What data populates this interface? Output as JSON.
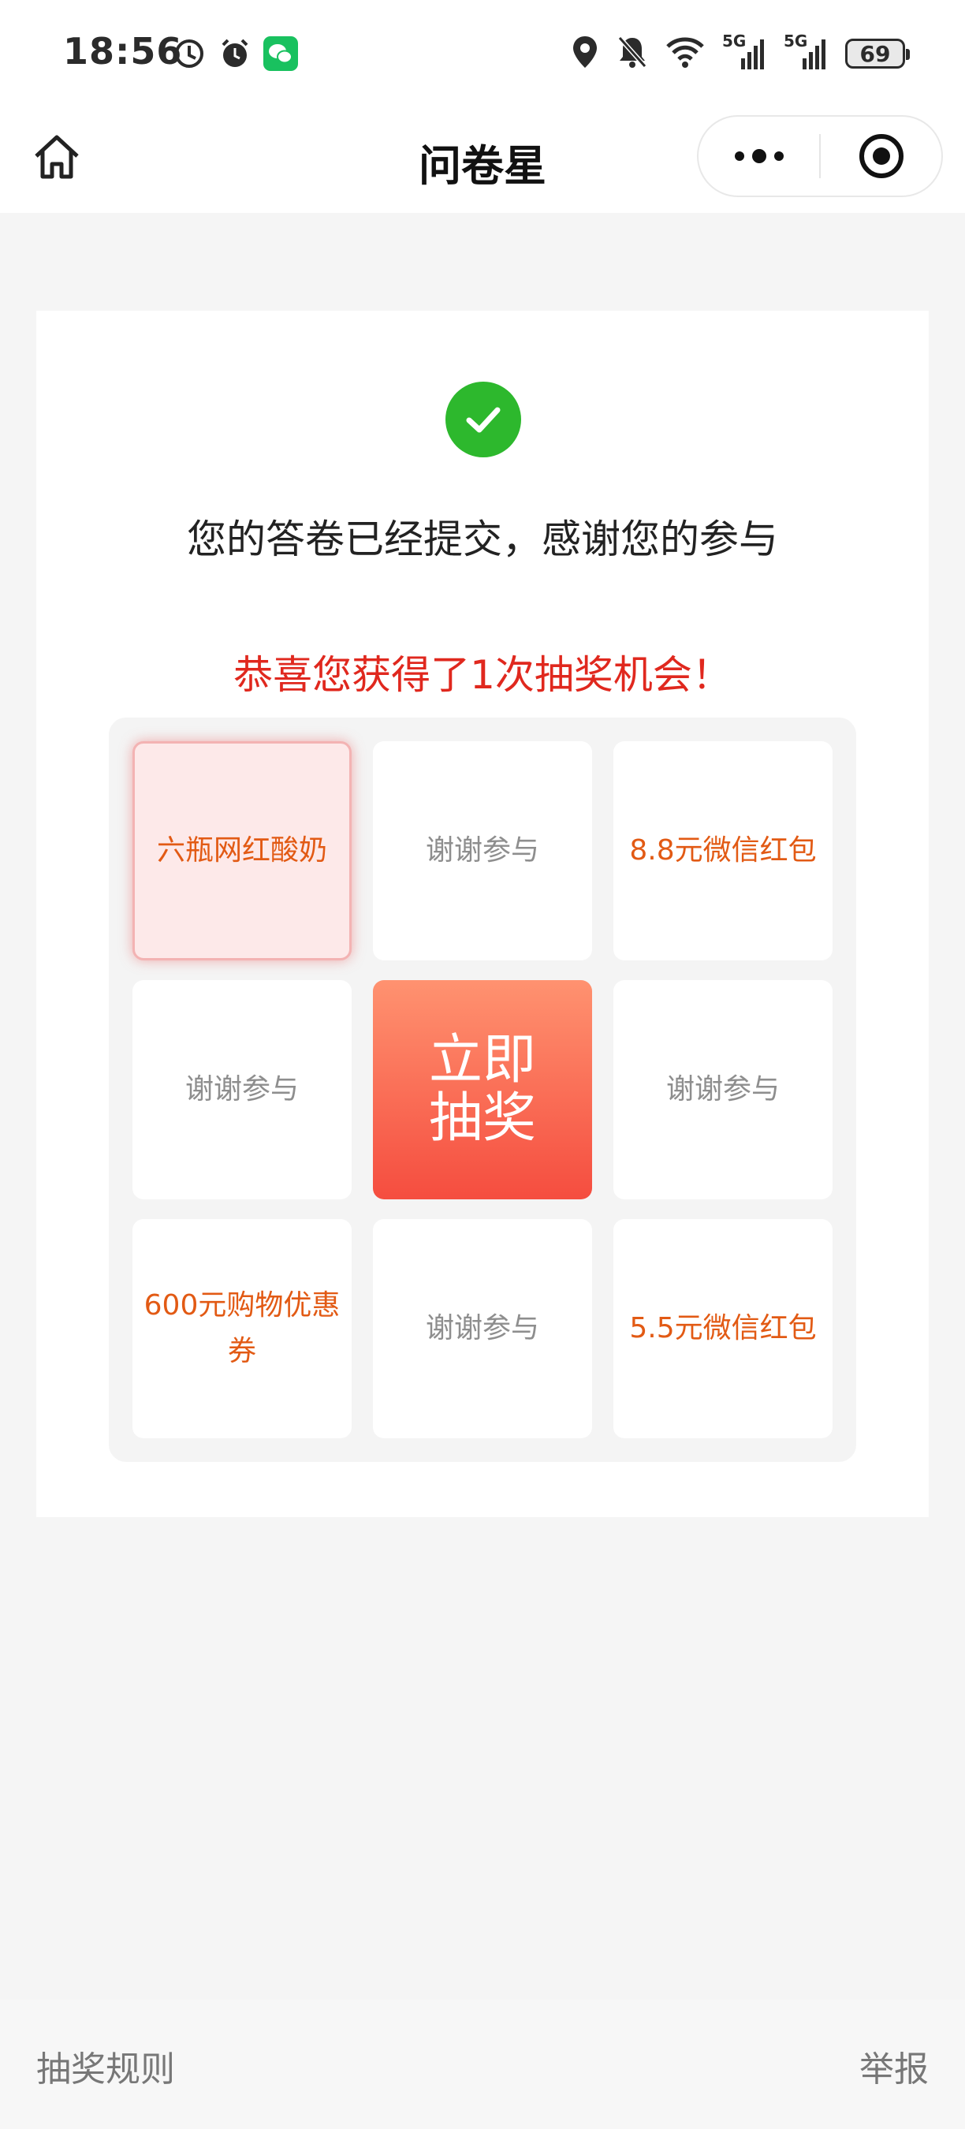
{
  "status_bar": {
    "time": "18:56",
    "battery": "69",
    "network_1": "5G",
    "network_2": "5G",
    "left_icons": [
      "data-saver-icon",
      "alarm-icon",
      "wechat-icon"
    ],
    "right_icons": [
      "location-icon",
      "mute-icon",
      "wifi-icon",
      "signal-icon",
      "signal-icon",
      "battery-icon"
    ]
  },
  "nav": {
    "title": "问卷星",
    "home_icon": "home-icon",
    "more_icon": "more-dots-icon",
    "close_icon": "mini-program-close-icon"
  },
  "result": {
    "success_icon": "check-circle-icon",
    "message": "您的答卷已经提交，感谢您的参与",
    "congrats": "恭喜您获得了1次抽奖机会！"
  },
  "lottery": {
    "cells": [
      {
        "label": "六瓶网红酸奶",
        "type": "prize",
        "active": true
      },
      {
        "label": "谢谢参与",
        "type": "thanks"
      },
      {
        "label": "8.8元微信红包",
        "type": "prize"
      },
      {
        "label": "谢谢参与",
        "type": "thanks"
      },
      {
        "label": "立即抽奖",
        "type": "button"
      },
      {
        "label": "谢谢参与",
        "type": "thanks"
      },
      {
        "label": "600元购物优惠券",
        "type": "prize"
      },
      {
        "label": "谢谢参与",
        "type": "thanks"
      },
      {
        "label": "5.5元微信红包",
        "type": "prize"
      }
    ]
  },
  "footer": {
    "rules": "抽奖规则",
    "report": "举报"
  },
  "colors": {
    "success": "#2db82d",
    "congrats_text": "#e0281e",
    "prize_text": "#e25a14",
    "thanks_text": "#8e8e8e",
    "draw_button_top": "#ff9270",
    "draw_button_bottom": "#f54d3f"
  }
}
